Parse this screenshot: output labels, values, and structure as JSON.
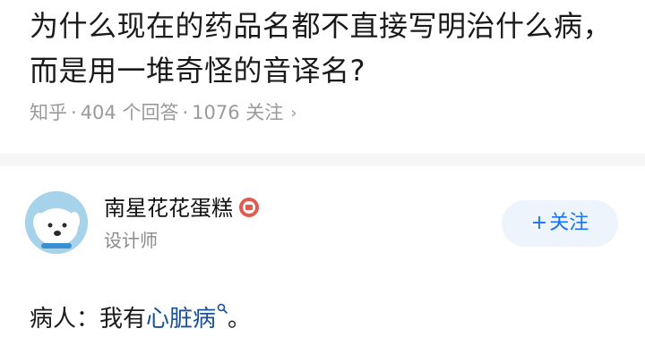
{
  "question": {
    "title": "为什么现在的药品名都不直接写明治什么病，而是用一堆奇怪的音译名?",
    "source": "知乎",
    "answers": "404 个回答",
    "followers": "1076 关注",
    "more_icon": "chevron-right-icon"
  },
  "answer": {
    "author": {
      "name": "南星花花蛋糕",
      "title": "设计师",
      "badge_icon": "red-badge-icon",
      "avatar_icon": "dog-avatar"
    },
    "follow_label": "关注",
    "follow_plus": "+",
    "body_prefix": "病人：我有",
    "body_link": "心脏病",
    "body_suffix": "。",
    "search_icon": "search-icon"
  },
  "colors": {
    "accent": "#1772f6",
    "link": "#175199",
    "meta": "#9a9a9a",
    "badge": "#e35a4f"
  }
}
